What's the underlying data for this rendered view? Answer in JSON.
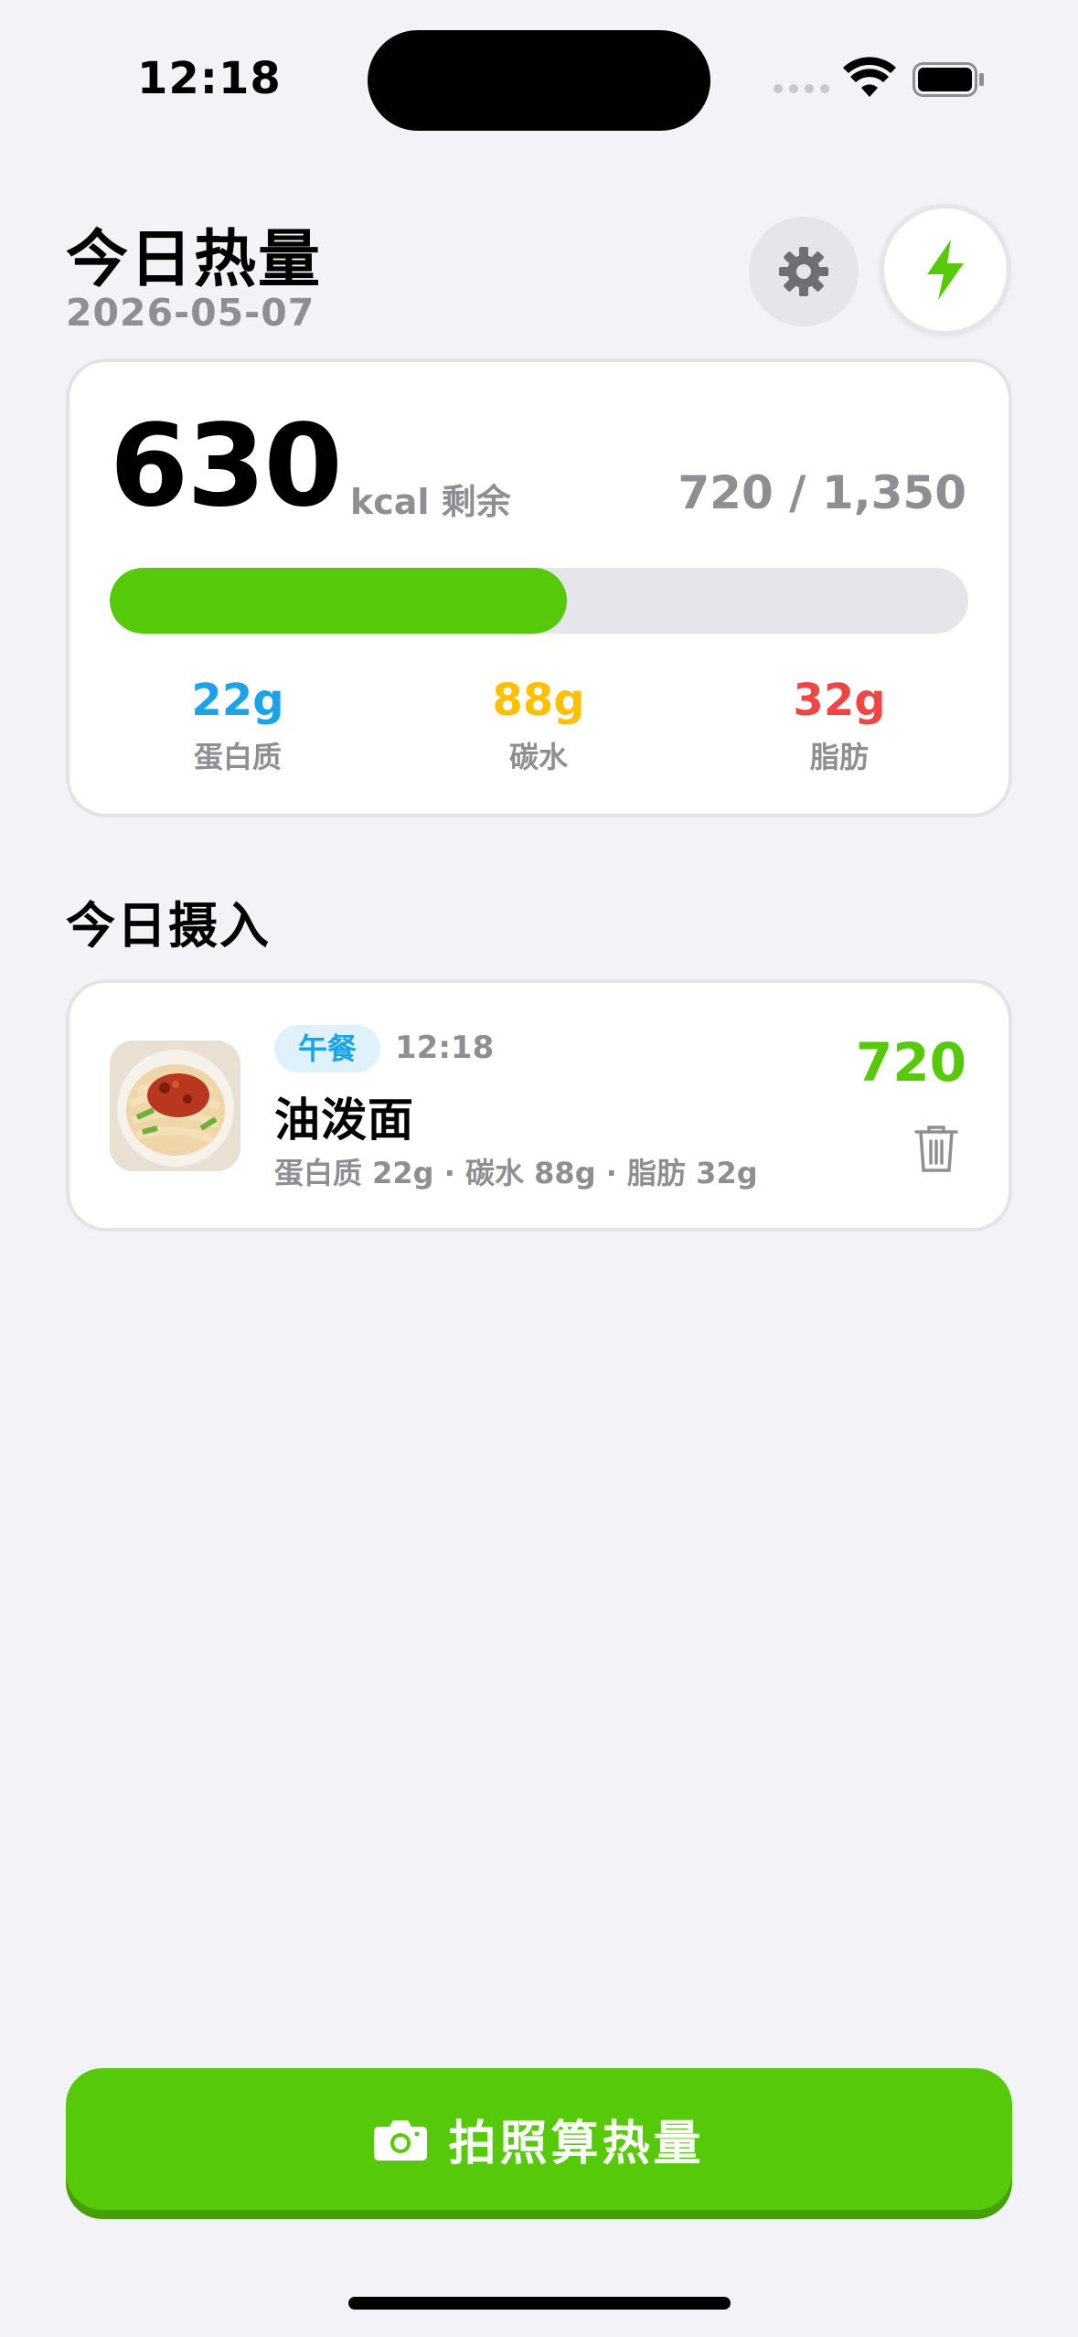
{
  "status_bar": {
    "time": "12:18"
  },
  "header": {
    "title": "今日热量",
    "date": "2026-05-07"
  },
  "summary": {
    "remaining": "630",
    "unit_label": "kcal 剩余",
    "ratio": "720 / 1,350",
    "progress_fraction": 0.533,
    "macros": [
      {
        "value": "22g",
        "label": "蛋白质",
        "color": "#1aa3e8"
      },
      {
        "value": "88g",
        "label": "碳水",
        "color": "#ffc000"
      },
      {
        "value": "32g",
        "label": "脂肪",
        "color": "#f04545"
      }
    ]
  },
  "intake": {
    "section_title": "今日摄入",
    "entries": [
      {
        "meal_tag": "午餐",
        "time": "12:18",
        "name": "油泼面",
        "macros": "蛋白质 22g · 碳水 88g · 脂肪 32g",
        "kcal": "720"
      }
    ]
  },
  "cta": {
    "label": "拍照算热量"
  },
  "colors": {
    "accent": "#56c90a",
    "background": "#f2f2f7"
  }
}
